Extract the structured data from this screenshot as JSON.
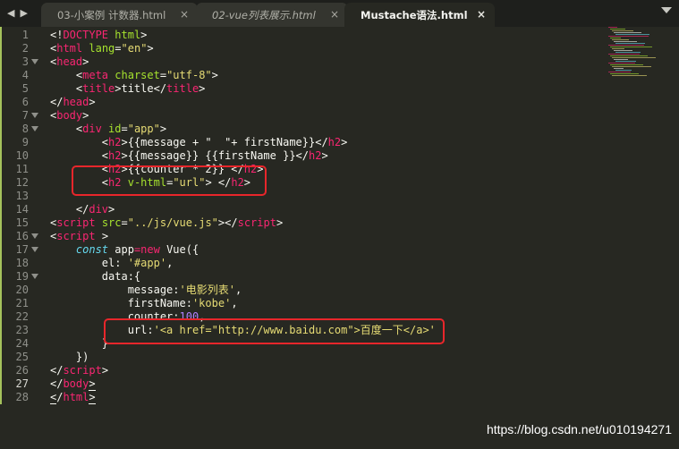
{
  "tabs": [
    {
      "label": "03-小案例 计数器.html",
      "close": "×"
    },
    {
      "label": "02-vue列表展示.html",
      "close": "×"
    },
    {
      "label": "Mustache语法.html",
      "close": "×"
    }
  ],
  "nav": {
    "back": "◀",
    "forward": "▶"
  },
  "lines": [
    {
      "n": "1",
      "html": "<span class='t-txt'>&lt;!</span><span class='t-tag'>DOCTYPE</span> <span class='t-attr'>html</span><span class='t-txt'>&gt;</span>"
    },
    {
      "n": "2",
      "html": "&lt;<span class='t-tag'>html</span> <span class='t-attr'>lang</span>=<span class='t-str'>\"en\"</span>&gt;"
    },
    {
      "n": "3",
      "fold": true,
      "html": "&lt;<span class='t-tag'>head</span>&gt;"
    },
    {
      "n": "4",
      "html": "    &lt;<span class='t-tag'>meta</span> <span class='t-attr'>charset</span>=<span class='t-str'>\"utf-8\"</span>&gt;"
    },
    {
      "n": "5",
      "html": "    &lt;<span class='t-tag'>title</span>&gt;title&lt;/<span class='t-tag'>title</span>&gt;"
    },
    {
      "n": "6",
      "html": "&lt;/<span class='t-tag'>head</span>&gt;"
    },
    {
      "n": "7",
      "fold": true,
      "html": "&lt;<span class='t-tag'>body</span>&gt;"
    },
    {
      "n": "8",
      "fold": true,
      "html": "    &lt;<span class='t-tag'>div</span> <span class='t-attr'>id</span>=<span class='t-str'>\"app\"</span>&gt;"
    },
    {
      "n": "9",
      "html": "        &lt;<span class='t-tag'>h2</span>&gt;{{message + \"  \"+ firstName}}&lt;/<span class='t-tag'>h2</span>&gt;"
    },
    {
      "n": "10",
      "html": "        &lt;<span class='t-tag'>h2</span>&gt;{{message}} {{firstName }}&lt;/<span class='t-tag'>h2</span>&gt;"
    },
    {
      "n": "11",
      "html": "        &lt;<span class='t-tag'>h2</span>&gt;{{counter * 2}} &lt;/<span class='t-tag'>h2</span>&gt;"
    },
    {
      "n": "12",
      "html": "        &lt;<span class='t-tag'>h2</span> <span class='t-attr'>v-html</span>=<span class='t-str'>\"url\"</span>&gt; &lt;/<span class='t-tag'>h2</span>&gt;"
    },
    {
      "n": "13",
      "html": ""
    },
    {
      "n": "14",
      "html": "    &lt;/<span class='t-tag'>div</span>&gt;"
    },
    {
      "n": "15",
      "html": "&lt;<span class='t-tag'>script</span> <span class='t-attr'>src</span>=<span class='t-str'>\"../js/vue.js\"</span>&gt;&lt;/<span class='t-tag'>script</span>&gt;"
    },
    {
      "n": "16",
      "fold": true,
      "html": "&lt;<span class='t-tag'>script</span> &gt;"
    },
    {
      "n": "17",
      "fold": true,
      "html": "    <span class='t-kw'>const</span> app<span class='t-op'>=</span><span class='t-op'>new</span> Vue({"
    },
    {
      "n": "18",
      "html": "        el: <span class='t-str'>'#app'</span>,"
    },
    {
      "n": "19",
      "fold": true,
      "html": "        data:{"
    },
    {
      "n": "20",
      "html": "            message:<span class='t-str'>'电影列表'</span>,"
    },
    {
      "n": "21",
      "html": "            firstName:<span class='t-str'>'kobe'</span>,"
    },
    {
      "n": "22",
      "html": "            counter:<span class='t-num'>100</span>,"
    },
    {
      "n": "23",
      "html": "            url:<span class='t-str'>'&lt;a href=\"http://www.baidu.com\"&gt;百度一下&lt;/a&gt;'</span>"
    },
    {
      "n": "24",
      "html": "        }"
    },
    {
      "n": "25",
      "html": "    })"
    },
    {
      "n": "26",
      "html": "&lt;/<span class='t-tag'>script</span>&gt;"
    },
    {
      "n": "27",
      "current": true,
      "html": "&lt;/<span class='t-tag'>body</span><span class='hl-bracket'>&gt;</span>"
    },
    {
      "n": "28",
      "html": "<span class='hl-bracket'>&lt;</span>/<span class='t-tag'>html</span><span class='hl-bracket'>&gt;</span>"
    }
  ],
  "watermark": "https://blog.csdn.net/u010194271"
}
